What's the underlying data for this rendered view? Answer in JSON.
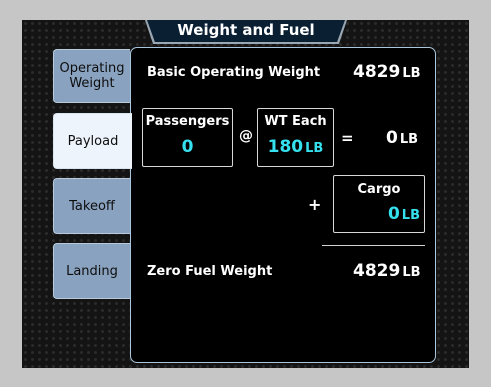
{
  "title": "Weight and Fuel",
  "tabs": [
    {
      "label": "Operating Weight",
      "active": false
    },
    {
      "label": "Payload",
      "active": true
    },
    {
      "label": "Takeoff",
      "active": false
    },
    {
      "label": "Landing",
      "active": false
    }
  ],
  "basic_operating_weight": {
    "label": "Basic Operating Weight",
    "value": "4829",
    "unit": "LB"
  },
  "passengers": {
    "label": "Passengers",
    "value": "0"
  },
  "at_symbol": "@",
  "wt_each": {
    "label": "WT Each",
    "value": "180",
    "unit": "LB"
  },
  "equals_symbol": "=",
  "passenger_total": {
    "value": "0",
    "unit": "LB"
  },
  "plus_symbol": "+",
  "cargo": {
    "label": "Cargo",
    "value": "0",
    "unit": "LB"
  },
  "zero_fuel_weight": {
    "label": "Zero Fuel Weight",
    "value": "4829",
    "unit": "LB"
  },
  "colors": {
    "accent_cyan": "#35e0ef",
    "tab_blue": "#89a2bf",
    "tab_active": "#eef4fb",
    "panel_border": "#a9c6dd"
  }
}
